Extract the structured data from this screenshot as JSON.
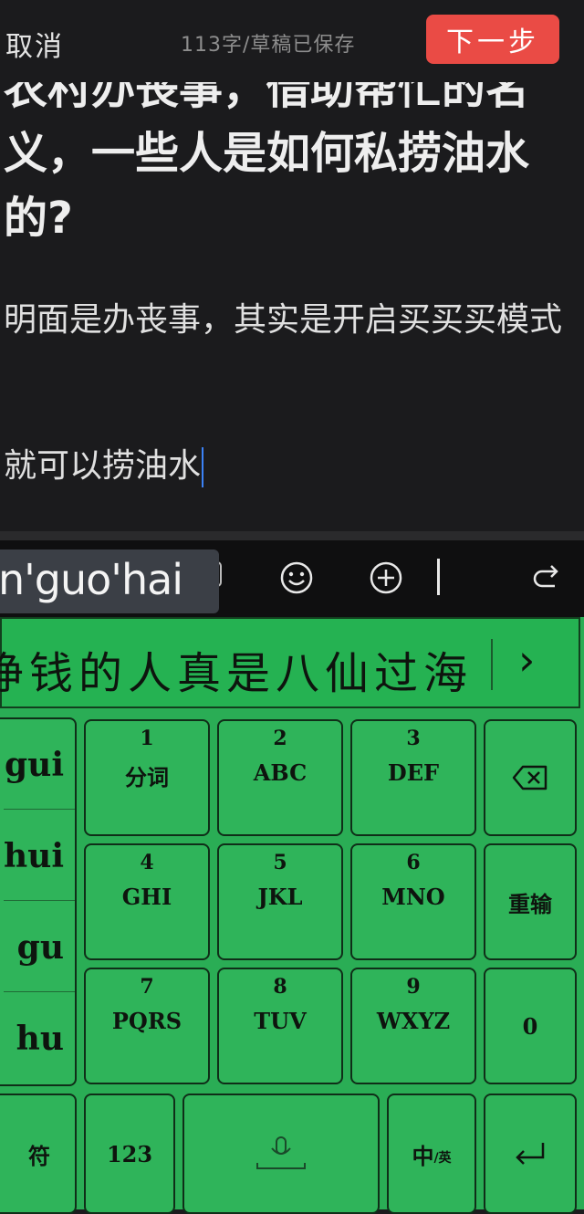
{
  "header": {
    "cancel_label": "取消",
    "word_count": "113字/草稿已保存",
    "next_label": "下一步"
  },
  "editor": {
    "title": "农村办丧事，借助帮忙的名义，一些人是如何私捞油水的?",
    "paragraphs": [
      "明面是办丧事，其实是开启买买买模式",
      "就可以捞油水"
    ]
  },
  "ime": {
    "composing_text": "n'guo'hai",
    "candidates": "挣钱的人真是八仙过海",
    "pinyin_options": [
      "gui",
      "hui",
      "gu",
      "hu"
    ],
    "keys_row1": [
      {
        "num": "1",
        "label": "分词"
      },
      {
        "num": "2",
        "label": "ABC"
      },
      {
        "num": "3",
        "label": "DEF"
      }
    ],
    "keys_row2": [
      {
        "num": "4",
        "label": "GHI"
      },
      {
        "num": "5",
        "label": "JKL"
      },
      {
        "num": "6",
        "label": "MNO"
      }
    ],
    "keys_row3": [
      {
        "num": "7",
        "label": "PQRS"
      },
      {
        "num": "8",
        "label": "TUV"
      },
      {
        "num": "9",
        "label": "WXYZ"
      }
    ],
    "reenter_label": "重输",
    "zero_label": "0",
    "symbol_label": "符",
    "numeric_label": "123",
    "lang_label_main": "中",
    "lang_label_sub": "/英"
  },
  "colors": {
    "accent_next": "#ea4b45",
    "keyboard_bg": "#2aad55",
    "caret": "#3b82f6"
  }
}
